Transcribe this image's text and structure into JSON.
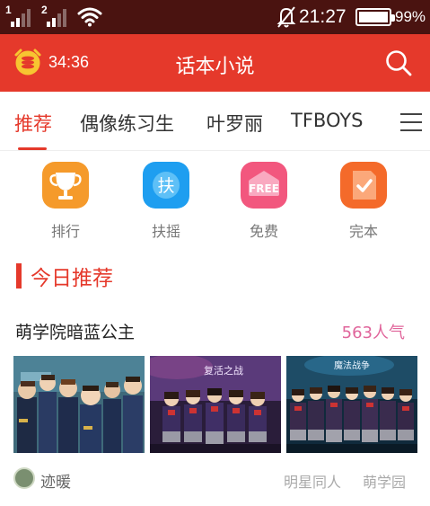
{
  "status_bar": {
    "sim1": "1",
    "sim2": "2",
    "time": "21:27",
    "battery": "99%"
  },
  "header": {
    "timer": "34:36",
    "title": "话本小说"
  },
  "tabs": [
    {
      "label": "推荐"
    },
    {
      "label": "偶像练习生"
    },
    {
      "label": "叶罗丽"
    },
    {
      "label": "TFBOYS"
    }
  ],
  "quick_links": [
    {
      "label": "排行",
      "icon": "trophy-icon",
      "color": "#f59a2b"
    },
    {
      "label": "扶摇",
      "icon": "fuyao-icon",
      "glyph": "扶",
      "color": "#1e9ef0"
    },
    {
      "label": "免费",
      "icon": "free-icon",
      "glyph": "FREE",
      "color": "#f2577e"
    },
    {
      "label": "完本",
      "icon": "complete-icon",
      "color": "#f46a2a"
    }
  ],
  "section": {
    "title": "今日推荐"
  },
  "book": {
    "title": "萌学院暗蓝公主",
    "popularity": "563人气",
    "author": "迹暖",
    "tags": [
      "明星同人",
      "萌学园"
    ],
    "cover_banners": [
      "复活之战",
      "魔法战争"
    ]
  },
  "colors": {
    "accent": "#e5392b",
    "status_bar": "#4a1310",
    "popularity": "#e0659b"
  }
}
